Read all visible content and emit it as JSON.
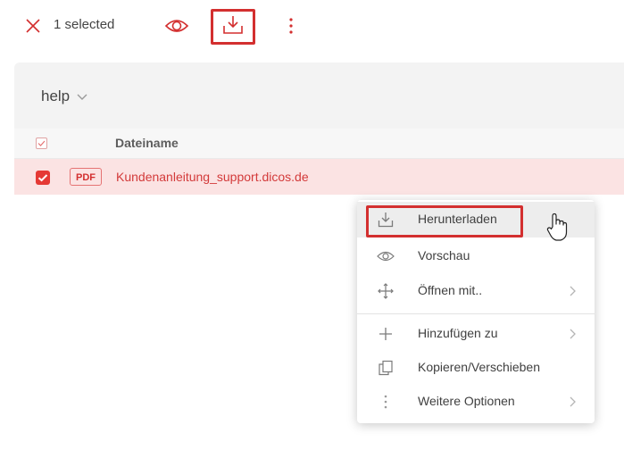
{
  "toolbar": {
    "selected_label": "1 selected",
    "icons": {
      "close": "close-icon",
      "preview": "eye-icon",
      "download": "download-icon",
      "more": "more-vertical-icon"
    },
    "highlight_color": "#d32f2f"
  },
  "breadcrumb": {
    "folder": "help"
  },
  "table": {
    "columns": [
      "Dateiname"
    ],
    "rows": [
      {
        "type": "PDF",
        "name": "Kundenanleitung_support.dicos.de",
        "selected": true
      }
    ]
  },
  "context_menu": {
    "items": [
      {
        "label": "Herunterladen",
        "icon": "download-icon",
        "submenu": false
      },
      {
        "label": "Vorschau",
        "icon": "eye-icon",
        "submenu": false
      },
      {
        "label": "Öffnen mit..",
        "icon": "move-arrows-icon",
        "submenu": true
      },
      {
        "label": "Hinzufügen zu",
        "icon": "plus-icon",
        "submenu": true
      },
      {
        "label": "Kopieren/Verschieben",
        "icon": "copy-icon",
        "submenu": false
      },
      {
        "label": "Weitere Optionen",
        "icon": "more-vertical-icon",
        "submenu": true
      }
    ]
  },
  "colors": {
    "accent": "#e53935",
    "selected_row": "#fbe3e3",
    "panel": "#f3f3f3"
  }
}
